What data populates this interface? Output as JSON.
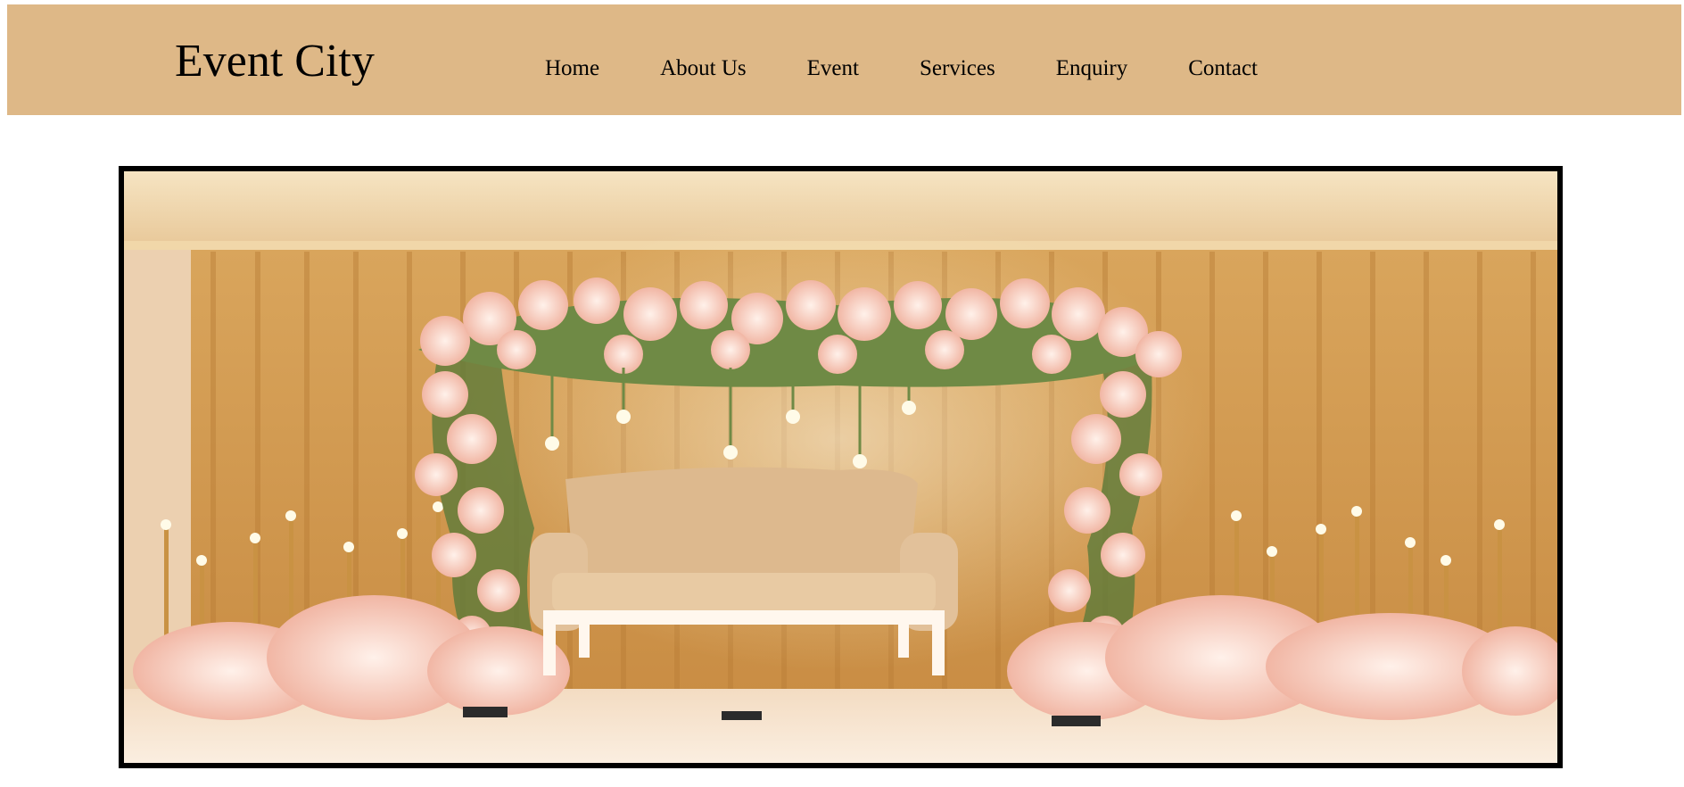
{
  "header": {
    "logo": "Event City",
    "nav": [
      {
        "label": "Home"
      },
      {
        "label": "About Us"
      },
      {
        "label": "Event"
      },
      {
        "label": "Services"
      },
      {
        "label": "Enquiry"
      },
      {
        "label": "Contact"
      }
    ]
  },
  "hero": {
    "image_subject": "wedding-stage-floral-arch"
  },
  "colors": {
    "header_bg": "#deb887",
    "hero_border": "#000000"
  }
}
